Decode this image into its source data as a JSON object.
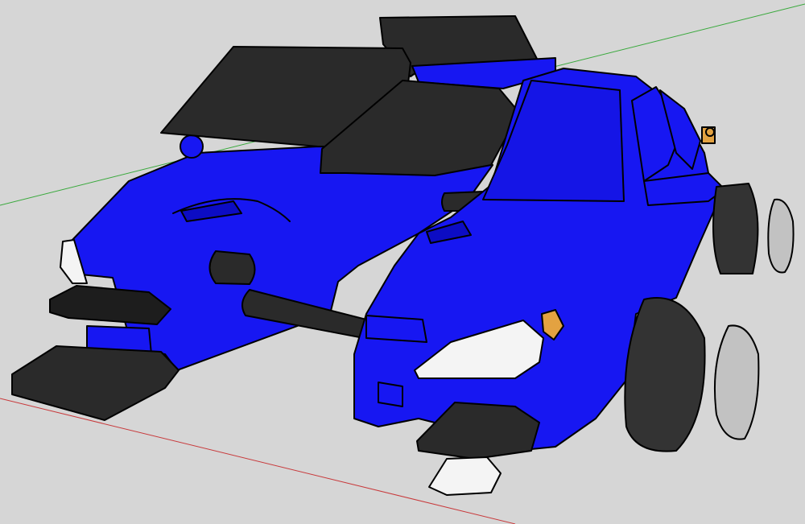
{
  "viewport": {
    "background": "#d6d6d6",
    "axes": {
      "green_axis": "#39a93c",
      "red_axis": "#c8393b"
    }
  },
  "model": {
    "palette": {
      "body_blue": "#1717f2",
      "body_blue_dark": "#0c0cc4",
      "black_part": "#2a2a2a",
      "black_part_dark": "#151515",
      "tire": "#333333",
      "rim": "#c2c2c2",
      "headlight": "#f4f4f4",
      "amber": "#e3a241",
      "outline": "#000000"
    }
  }
}
